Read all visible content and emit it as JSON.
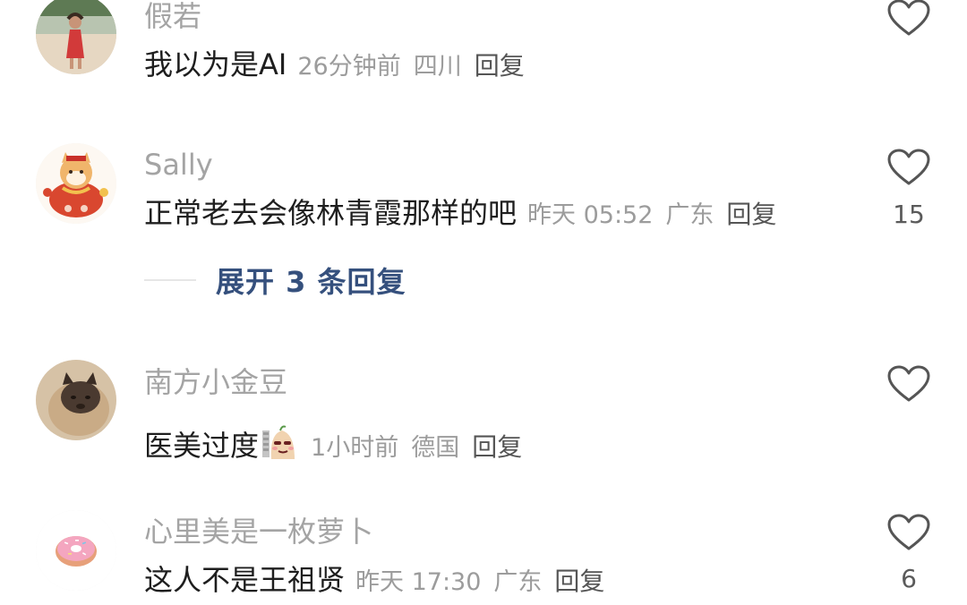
{
  "comments": [
    {
      "username": "假若",
      "text": "我以为是AI",
      "time": "26分钟前",
      "location": "四川",
      "reply_label": "回复",
      "like_count": "",
      "avatar_icon": "avatar-photo-woman-red-dress"
    },
    {
      "username": "Sally",
      "text": "正常老去会像林青霞那样的吧",
      "time": "昨天 05:52",
      "location": "广东",
      "reply_label": "回复",
      "like_count": "15",
      "expand_label": "展开 3 条回复",
      "avatar_icon": "avatar-shiba-lucky-bag"
    },
    {
      "username": "南方小金豆",
      "text": "医美过度",
      "time": "1小时前",
      "location": "德国",
      "reply_label": "回复",
      "like_count": "",
      "emoji_icon": "emoji-smug-face",
      "avatar_icon": "avatar-cat-photo"
    },
    {
      "username": "心里美是一枚萝卜",
      "text": "这人不是王祖贤",
      "time": "昨天 17:30",
      "location": "广东",
      "reply_label": "回复",
      "like_count": "6",
      "avatar_icon": "avatar-pink-donut"
    }
  ],
  "colors": {
    "username": "#a4a4a4",
    "text": "#1e1e1e",
    "meta": "#9c9c9c",
    "expand": "#35507d",
    "like_icon": "#555555"
  },
  "icons": {
    "like": "heart-outline-icon"
  }
}
